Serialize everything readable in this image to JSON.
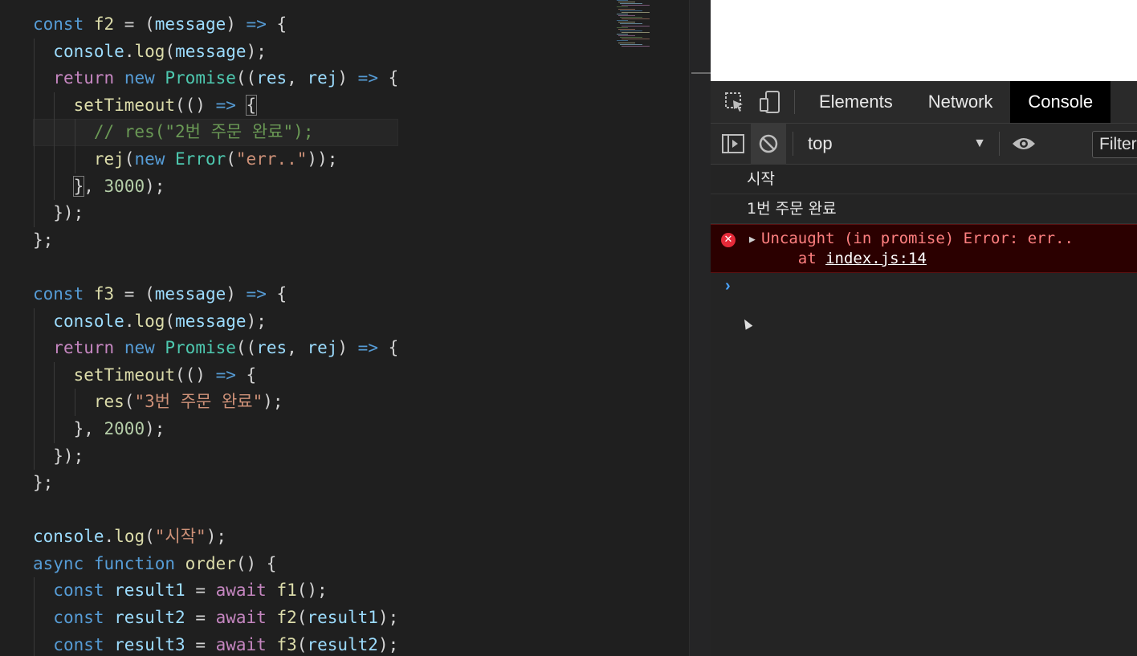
{
  "editor": {
    "lines": [
      [
        [
          "kw",
          "const "
        ],
        [
          "fn",
          "f2"
        ],
        [
          "pun",
          " = ("
        ],
        [
          "var",
          "message"
        ],
        [
          "pun",
          ") "
        ],
        [
          "kw",
          "=>"
        ],
        [
          "pun",
          " {"
        ]
      ],
      [
        [
          "pun",
          "  "
        ],
        [
          "var",
          "console"
        ],
        [
          "pun",
          "."
        ],
        [
          "fn",
          "log"
        ],
        [
          "pun",
          "("
        ],
        [
          "var",
          "message"
        ],
        [
          "pun",
          ");"
        ]
      ],
      [
        [
          "pun",
          "  "
        ],
        [
          "kw2",
          "return "
        ],
        [
          "kw",
          "new "
        ],
        [
          "cls",
          "Promise"
        ],
        [
          "pun",
          "(("
        ],
        [
          "var",
          "res"
        ],
        [
          "pun",
          ", "
        ],
        [
          "var",
          "rej"
        ],
        [
          "pun",
          ") "
        ],
        [
          "kw",
          "=>"
        ],
        [
          "pun",
          " {"
        ]
      ],
      [
        [
          "pun",
          "    "
        ],
        [
          "fn",
          "setTimeout"
        ],
        [
          "pun",
          "(() "
        ],
        [
          "kw",
          "=>"
        ],
        [
          "pun",
          " "
        ],
        [
          "box",
          "{"
        ]
      ],
      [
        [
          "pun",
          "      "
        ],
        [
          "cmt",
          "// res(\"2번 주문 완료\");"
        ]
      ],
      [
        [
          "pun",
          "      "
        ],
        [
          "fn",
          "rej"
        ],
        [
          "pun",
          "("
        ],
        [
          "kw",
          "new "
        ],
        [
          "cls",
          "Error"
        ],
        [
          "pun",
          "("
        ],
        [
          "str",
          "\"err..\""
        ],
        [
          "pun",
          "));"
        ]
      ],
      [
        [
          "pun",
          "    "
        ],
        [
          "box",
          "}"
        ],
        [
          "pun",
          ", "
        ],
        [
          "num",
          "3000"
        ],
        [
          "pun",
          ");"
        ]
      ],
      [
        [
          "pun",
          "  });"
        ]
      ],
      [
        [
          "pun",
          "};"
        ]
      ],
      [],
      [
        [
          "kw",
          "const "
        ],
        [
          "fn",
          "f3"
        ],
        [
          "pun",
          " = ("
        ],
        [
          "var",
          "message"
        ],
        [
          "pun",
          ") "
        ],
        [
          "kw",
          "=>"
        ],
        [
          "pun",
          " {"
        ]
      ],
      [
        [
          "pun",
          "  "
        ],
        [
          "var",
          "console"
        ],
        [
          "pun",
          "."
        ],
        [
          "fn",
          "log"
        ],
        [
          "pun",
          "("
        ],
        [
          "var",
          "message"
        ],
        [
          "pun",
          ");"
        ]
      ],
      [
        [
          "pun",
          "  "
        ],
        [
          "kw2",
          "return "
        ],
        [
          "kw",
          "new "
        ],
        [
          "cls",
          "Promise"
        ],
        [
          "pun",
          "(("
        ],
        [
          "var",
          "res"
        ],
        [
          "pun",
          ", "
        ],
        [
          "var",
          "rej"
        ],
        [
          "pun",
          ") "
        ],
        [
          "kw",
          "=>"
        ],
        [
          "pun",
          " {"
        ]
      ],
      [
        [
          "pun",
          "    "
        ],
        [
          "fn",
          "setTimeout"
        ],
        [
          "pun",
          "(() "
        ],
        [
          "kw",
          "=>"
        ],
        [
          "pun",
          " {"
        ]
      ],
      [
        [
          "pun",
          "      "
        ],
        [
          "fn",
          "res"
        ],
        [
          "pun",
          "("
        ],
        [
          "str",
          "\"3번 주문 완료\""
        ],
        [
          "pun",
          ");"
        ]
      ],
      [
        [
          "pun",
          "    }, "
        ],
        [
          "num",
          "2000"
        ],
        [
          "pun",
          ");"
        ]
      ],
      [
        [
          "pun",
          "  });"
        ]
      ],
      [
        [
          "pun",
          "};"
        ]
      ],
      [],
      [
        [
          "var",
          "console"
        ],
        [
          "pun",
          "."
        ],
        [
          "fn",
          "log"
        ],
        [
          "pun",
          "("
        ],
        [
          "str",
          "\"시작\""
        ],
        [
          "pun",
          ");"
        ]
      ],
      [
        [
          "kw",
          "async "
        ],
        [
          "kw",
          "function "
        ],
        [
          "fn",
          "order"
        ],
        [
          "pun",
          "() {"
        ]
      ],
      [
        [
          "pun",
          "  "
        ],
        [
          "kw",
          "const "
        ],
        [
          "var",
          "result1"
        ],
        [
          "pun",
          " = "
        ],
        [
          "kw2",
          "await "
        ],
        [
          "fn",
          "f1"
        ],
        [
          "pun",
          "();"
        ]
      ],
      [
        [
          "pun",
          "  "
        ],
        [
          "kw",
          "const "
        ],
        [
          "var",
          "result2"
        ],
        [
          "pun",
          " = "
        ],
        [
          "kw2",
          "await "
        ],
        [
          "fn",
          "f2"
        ],
        [
          "pun",
          "("
        ],
        [
          "var",
          "result1"
        ],
        [
          "pun",
          ");"
        ]
      ],
      [
        [
          "pun",
          "  "
        ],
        [
          "kw",
          "const "
        ],
        [
          "var",
          "result3"
        ],
        [
          "pun",
          " = "
        ],
        [
          "kw2",
          "await "
        ],
        [
          "fn",
          "f3"
        ],
        [
          "pun",
          "("
        ],
        [
          "var",
          "result2"
        ],
        [
          "pun",
          ");"
        ]
      ]
    ],
    "cursor_line": 4
  },
  "devtools": {
    "tabs": [
      "Elements",
      "Network",
      "Console"
    ],
    "active_tab": "Console",
    "context": "top",
    "filter_placeholder": "Filter",
    "messages": [
      "시작",
      "1번 주문 완료"
    ],
    "error": {
      "line1": "Uncaught (in promise) Error: err..",
      "line2_prefix": "    at ",
      "link": "index.js:14"
    },
    "prompt": "›"
  },
  "colors": {
    "editor_bg": "#1f1f1f",
    "keyword": "#569cd6",
    "control": "#c586c0",
    "function": "#dcdcaa",
    "variable": "#9cdcfe",
    "class": "#4ec9b0",
    "string": "#ce9178",
    "number": "#b5cea8",
    "comment": "#6a9955",
    "error_bg": "#2b0000",
    "error_text": "#ff8080"
  }
}
